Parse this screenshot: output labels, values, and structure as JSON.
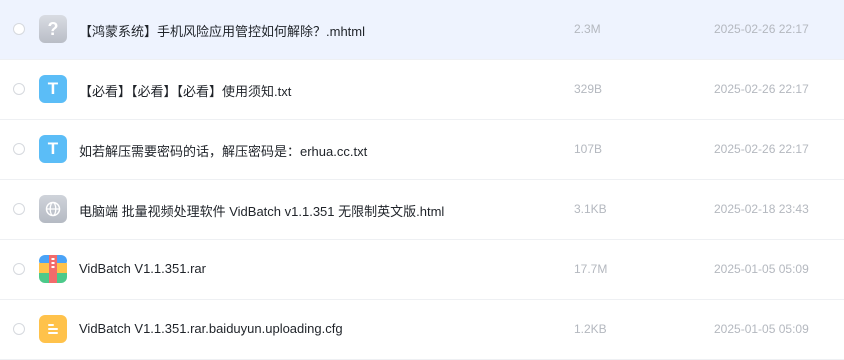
{
  "files": [
    {
      "name": "【鸿蒙系统】手机风险应用管控如何解除？.mhtml",
      "size": "2.3M",
      "date": "2025-02-26 22:17",
      "icon": "unknown-file-icon",
      "icon_glyph": "?",
      "selected": true
    },
    {
      "name": "【必看】【必看】【必看】使用须知.txt",
      "size": "329B",
      "date": "2025-02-26 22:17",
      "icon": "txt-file-icon",
      "icon_glyph": "T",
      "selected": false
    },
    {
      "name": "如若解压需要密码的话，解压密码是：erhua.cc.txt",
      "size": "107B",
      "date": "2025-02-26 22:17",
      "icon": "txt-file-icon",
      "icon_glyph": "T",
      "selected": false
    },
    {
      "name": "电脑端 批量视频处理软件 VidBatch v1.1.351 无限制英文版.html",
      "size": "3.1KB",
      "date": "2025-02-18 23:43",
      "icon": "web-file-icon",
      "icon_glyph": "",
      "selected": false
    },
    {
      "name": "VidBatch V1.1.351.rar",
      "size": "17.7M",
      "date": "2025-01-05 05:09",
      "icon": "archive-file-icon",
      "icon_glyph": "",
      "selected": false
    },
    {
      "name": "VidBatch V1.1.351.rar.baiduyun.uploading.cfg",
      "size": "1.2KB",
      "date": "2025-01-05 05:09",
      "icon": "document-file-icon",
      "icon_glyph": "",
      "selected": false
    }
  ],
  "colors": {
    "selected_row": "#eef3fe",
    "txt_icon": "#5bbdf7",
    "cfg_icon": "#ffc24b",
    "meta_text": "#b4b8bf"
  }
}
